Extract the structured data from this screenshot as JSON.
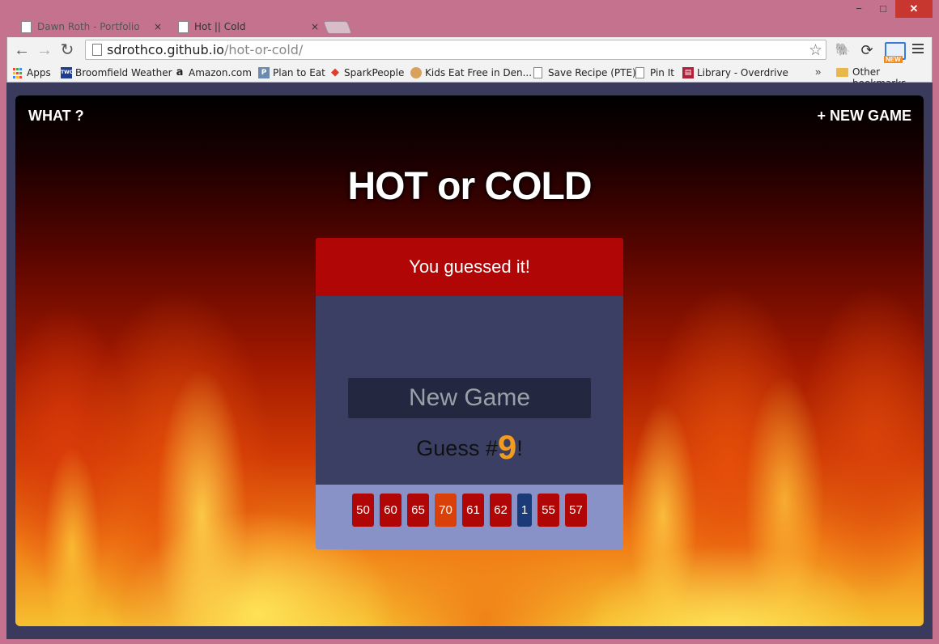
{
  "browser": {
    "tabs": [
      {
        "title": "Dawn Roth - Portfolio",
        "active": false
      },
      {
        "title": "Hot || Cold",
        "active": true
      }
    ],
    "tab_close": "×",
    "window_buttons": {
      "minimize": "−",
      "maximize": "□",
      "close": "✕"
    },
    "nav": {
      "back": "←",
      "forward": "→",
      "reload": "↻"
    },
    "url_host": "sdrothco.github.io",
    "url_path": "/hot-or-cold/",
    "star": "☆",
    "extensions": [
      {
        "name": "evernote-icon",
        "glyph": "🐘"
      },
      {
        "name": "sync-icon",
        "glyph": "⟳"
      }
    ],
    "ext_new_label": "NEW",
    "bookmarks": [
      {
        "label": "Apps",
        "icon": "apps-icon"
      },
      {
        "label": "Broomfield Weather",
        "icon": "twc-icon",
        "glyph": "TWC"
      },
      {
        "label": "Amazon.com",
        "icon": "amazon-icon",
        "glyph": "a"
      },
      {
        "label": "Plan to Eat",
        "icon": "pte-icon",
        "glyph": "P"
      },
      {
        "label": "SparkPeople",
        "icon": "sparkpeople-icon",
        "glyph": "◆"
      },
      {
        "label": "Kids Eat Free in Den...",
        "icon": "kids-icon",
        "glyph": ""
      },
      {
        "label": "Save Recipe (PTE)",
        "icon": "page-icon",
        "glyph": ""
      },
      {
        "label": "Pin It",
        "icon": "page-icon",
        "glyph": ""
      },
      {
        "label": "Library - Overdrive",
        "icon": "library-icon",
        "glyph": "▤"
      }
    ],
    "bookmarks_more": "»",
    "other_bookmarks": "Other bookmarks"
  },
  "game": {
    "nav_left": "WHAT ?",
    "nav_right": "+ NEW GAME",
    "title": "HOT or COLD",
    "feedback": "You guessed it!",
    "button_label": "New Game",
    "guess_prefix": "Guess #",
    "guess_count": "9",
    "guess_suffix": "!",
    "guesses": [
      {
        "value": "50",
        "temp": "hot"
      },
      {
        "value": "60",
        "temp": "hot"
      },
      {
        "value": "65",
        "temp": "hot"
      },
      {
        "value": "70",
        "temp": "warm"
      },
      {
        "value": "61",
        "temp": "hot"
      },
      {
        "value": "62",
        "temp": "hot"
      },
      {
        "value": "1",
        "temp": "cold"
      },
      {
        "value": "55",
        "temp": "hot"
      },
      {
        "value": "57",
        "temp": "hot"
      }
    ],
    "colors": {
      "hot": "#b00606",
      "warm": "#d9400a",
      "cold": "#1a3a78",
      "accent": "#f29c1f"
    }
  }
}
